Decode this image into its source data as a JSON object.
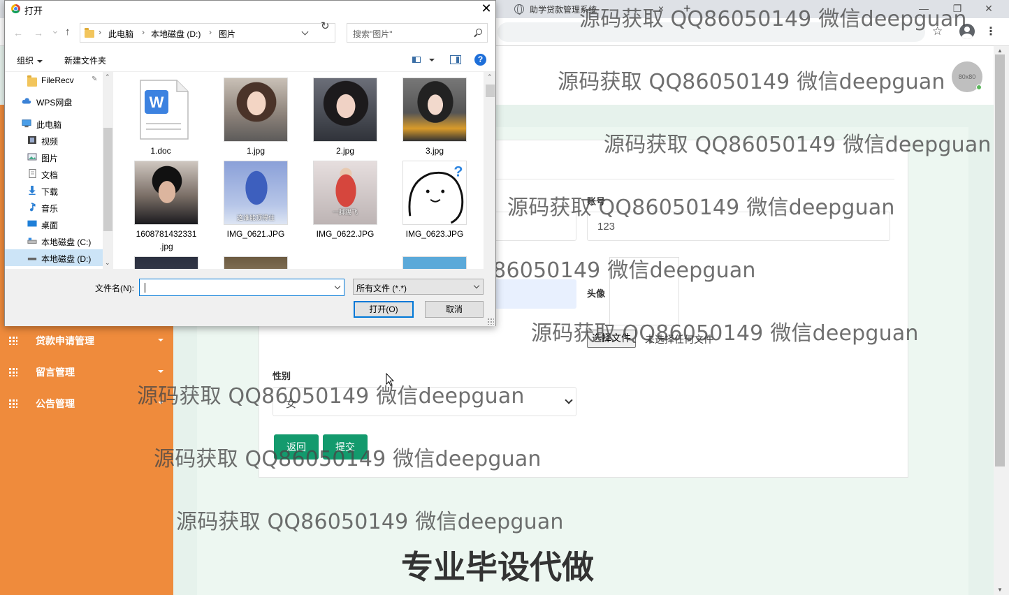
{
  "browser": {
    "tab_title": "助学贷款管理系统",
    "tab_close": "×",
    "new_tab": "+",
    "win_min": "—",
    "win_restore": "❐",
    "win_close": "✕",
    "star": "☆",
    "menu": "⋮"
  },
  "header": {
    "avatar_text": "80x80"
  },
  "sidebar": {
    "items": [
      {
        "label": "贷款申请管理",
        "icon": "grid-icon"
      },
      {
        "label": "留言管理",
        "icon": "grid-icon"
      },
      {
        "label": "公告管理",
        "icon": "grid-icon"
      }
    ]
  },
  "form": {
    "account_label": "账号",
    "account_value": "123",
    "avatar_label": "头像",
    "file_button": "选择文件",
    "file_status": "未选择任何文件",
    "gender_label": "性别",
    "gender_value": "女",
    "back_button": "返回",
    "submit_button": "提交"
  },
  "watermarks": [
    "源码获取 QQ86050149 微信deepguan",
    "源码获取 QQ86050149 微信deepguan",
    "源码获取 QQ86050149 微信deepguan",
    "源码获取 QQ86050149 微信deepguan",
    "源码获取 QQ86050149 微信deepguan",
    "源码获取 QQ86050149 微信deepguan",
    "源码获取 QQ86050149 微信deepguan",
    "源码获取 QQ86050149 微信deepguan",
    "源码获取 QQ86050149 微信deepguan"
  ],
  "banner": "专业毕设代做",
  "dialog": {
    "title": "打开",
    "close": "✕",
    "nav_back": "←",
    "nav_forward": "→",
    "nav_recent": "⌄",
    "nav_up": "↑",
    "breadcrumb": [
      "此电脑",
      "本地磁盘 (D:)",
      "图片"
    ],
    "refresh": "↻",
    "search_placeholder": "搜索\"图片\"",
    "organize": "组织",
    "new_folder": "新建文件夹",
    "help": "?",
    "nav_items": [
      {
        "label": "FileRecv",
        "icon": "folder-icon"
      },
      {
        "label": "WPS网盘",
        "icon": "cloud-icon"
      },
      {
        "label": "此电脑",
        "icon": "computer-icon"
      },
      {
        "label": "视频",
        "icon": "video-icon"
      },
      {
        "label": "图片",
        "icon": "pictures-icon"
      },
      {
        "label": "文档",
        "icon": "document-icon"
      },
      {
        "label": "下载",
        "icon": "download-icon"
      },
      {
        "label": "音乐",
        "icon": "music-icon"
      },
      {
        "label": "桌面",
        "icon": "desktop-icon"
      },
      {
        "label": "本地磁盘 (C:)",
        "icon": "drive-icon"
      },
      {
        "label": "本地磁盘 (D:)",
        "icon": "drive-icon"
      }
    ],
    "files": [
      {
        "name": "1.doc",
        "kind": "doc"
      },
      {
        "name": "1.jpg",
        "kind": "photo"
      },
      {
        "name": "2.jpg",
        "kind": "photo"
      },
      {
        "name": "3.jpg",
        "kind": "photo"
      },
      {
        "name": "1608781432331\n.jpg",
        "kind": "photo"
      },
      {
        "name": "IMG_0621.JPG",
        "kind": "photo",
        "caption": "这谁能顶得住"
      },
      {
        "name": "IMG_0622.JPG",
        "kind": "photo",
        "caption": "一脚踢飞"
      },
      {
        "name": "IMG_0623.JPG",
        "kind": "sticker"
      }
    ],
    "filename_label": "文件名(N):",
    "filetype_value": "所有文件 (*.*)",
    "open_button": "打开(O)",
    "cancel_button": "取消"
  }
}
